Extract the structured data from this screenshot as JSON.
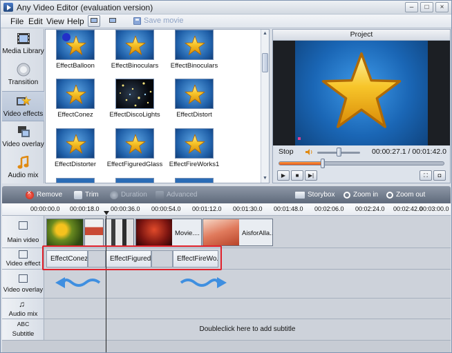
{
  "window": {
    "title": "Any Video Editor (evaluation version)",
    "buttons": [
      "–",
      "□",
      "×"
    ]
  },
  "menu": {
    "items": [
      "File",
      "Edit",
      "View",
      "Help"
    ],
    "save_movie": "Save movie"
  },
  "sidebar": {
    "items": [
      {
        "label": "Media Library",
        "icon": "film-icon"
      },
      {
        "label": "Transition",
        "icon": "transition-icon"
      },
      {
        "label": "Video effects",
        "icon": "star-effects-icon"
      },
      {
        "label": "Video overlay",
        "icon": "overlay-icon"
      },
      {
        "label": "Audio mix",
        "icon": "music-note-icon"
      }
    ]
  },
  "effects": [
    "EffectBalloon",
    "EffectBinoculars",
    "EffectBinoculars",
    "EffectConez",
    "EffectDiscoLights",
    "EffectDistort",
    "EffectDistorter",
    "EffectFiguredGlass",
    "EffectFireWorks1"
  ],
  "project": {
    "title": "Project",
    "stop_label": "Stop",
    "time": "00:00:27.1 / 00:01:42.0",
    "progress_fraction": 0.265,
    "volume_fraction": 0.5
  },
  "toolbar": {
    "remove": "Remove",
    "trim": "Trim",
    "duration": "Duration",
    "advanced": "Advanced",
    "storybox": "Storybox",
    "zoom_in": "Zoom in",
    "zoom_out": "Zoom out"
  },
  "ruler": [
    "00:00:00.0",
    "00:00:18.0",
    "00:00:36.0",
    "00:00:54.0",
    "00:01:12.0",
    "00:01:30.0",
    "00:01:48.0",
    "00:02:06.0",
    "00:02:24.0",
    "00:02:42.0",
    "00:03:00.0"
  ],
  "tracks": {
    "main_video": "Main video",
    "video_effect": "Video effect",
    "video_overlay": "Video overlay",
    "audio_mix": "Audio mix",
    "subtitle": "Subtitle",
    "subtitle_abc": "ABC"
  },
  "main_clips": {
    "movie": "Movie....",
    "aisfor": "AisforAlla..."
  },
  "effect_clips": [
    "EffectConez",
    "EffectFigured...",
    "EffectFireWo..."
  ],
  "subtitle_hint": "Doubleclick here to add subtitle",
  "colors": {
    "highlight_box": "#e0202a",
    "arrow": "#3f8fe0",
    "progress": "#e4561a"
  }
}
